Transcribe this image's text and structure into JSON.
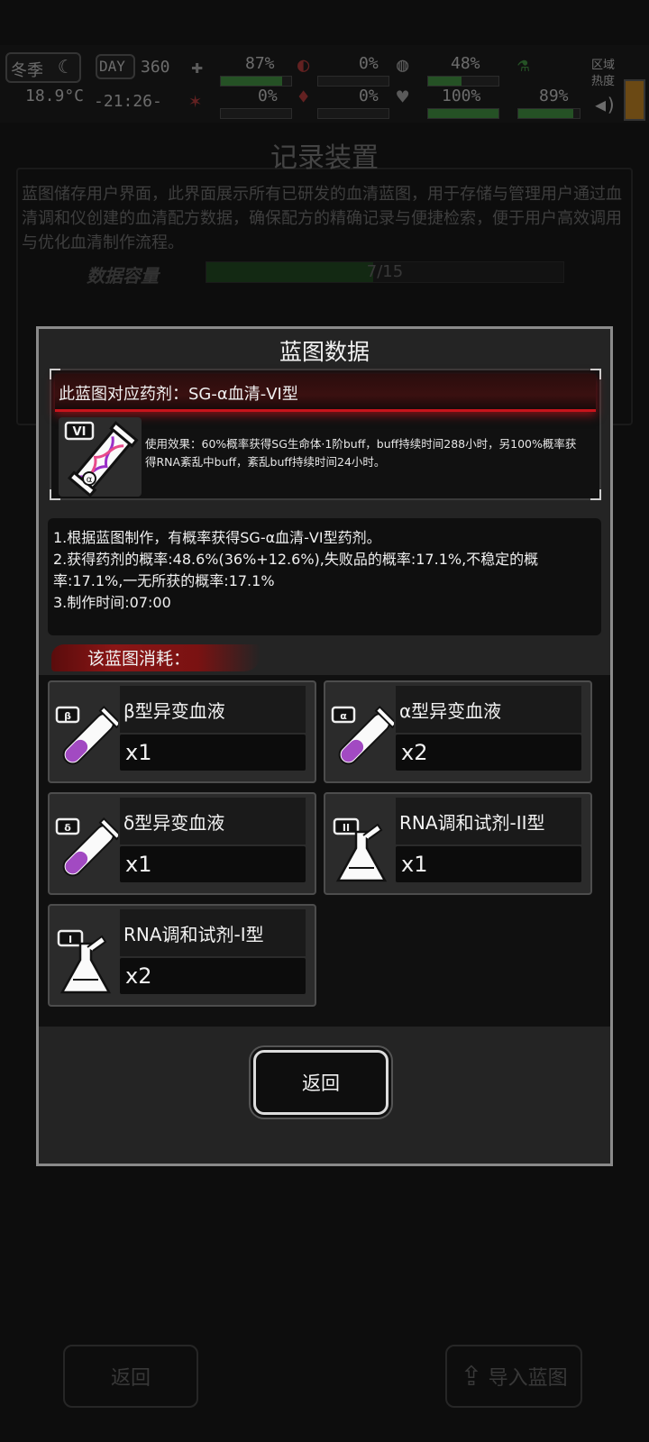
{
  "status": {
    "season": "冬季",
    "temperature": "18.9°C",
    "day_label": "DAY",
    "day_count": "360",
    "time": "-21:26-",
    "stats": [
      "87%",
      "0%",
      "48%",
      "0%",
      "0%",
      "100%",
      "89%"
    ],
    "region_label": "区域热度"
  },
  "background": {
    "title": "记录装置",
    "description": "蓝图储存用户界面，此界面展示所有已研发的血清蓝图，用于存储与管理用户通过血清调和仪创建的血清配方数据，确保配方的精确记录与便捷检索，便于用户高效调用与优化血清制作流程。",
    "capacity_label": "数据容量",
    "capacity_text": "7/15",
    "capacity_fraction": 0.467,
    "back_label": "返回",
    "import_label": "导入蓝图"
  },
  "modal": {
    "title": "蓝图数据",
    "medicine_line": "此蓝图对应药剂：SG-α血清-VI型",
    "medicine_badge": "VI",
    "effect": "使用效果：60%概率获得SG生命体·1阶buff，buff持续时间288小时，另100%概率获得RNA紊乱中buff，紊乱buff持续时间24小时。",
    "rules": [
      "1.根据蓝图制作，有概率获得SG-α血清-VI型药剂。",
      "2.获得药剂的概率:48.6%(36%+12.6%),失败品的概率:17.1%,不稳定的概率:17.1%,一无所获的概率:17.1%",
      "3.制作时间:07:00"
    ],
    "consume_label": "该蓝图消耗：",
    "items": [
      {
        "name": "β型异变血液",
        "qty": "x1",
        "badge": "β",
        "kind": "tube"
      },
      {
        "name": "α型异变血液",
        "qty": "x2",
        "badge": "α",
        "kind": "tube"
      },
      {
        "name": "δ型异变血液",
        "qty": "x1",
        "badge": "δ",
        "kind": "tube"
      },
      {
        "name": "RNA调和试剂-II型",
        "qty": "x1",
        "badge": "II",
        "kind": "flask"
      },
      {
        "name": "RNA调和试剂-I型",
        "qty": "x2",
        "badge": "I",
        "kind": "flask"
      }
    ],
    "return_label": "返回"
  }
}
